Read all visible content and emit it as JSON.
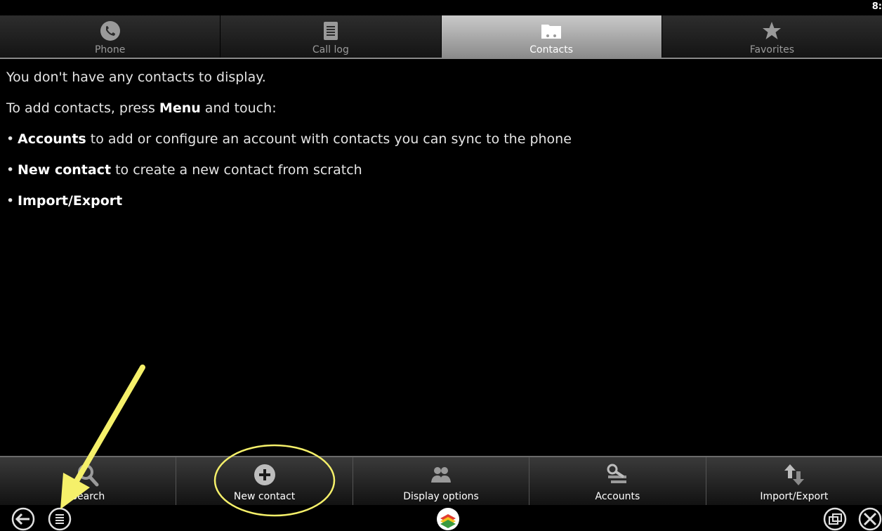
{
  "status": {
    "clock": "8:"
  },
  "tabs": [
    {
      "label": "Phone",
      "icon": "phone-icon",
      "active": false
    },
    {
      "label": "Call log",
      "icon": "call-log-icon",
      "active": false
    },
    {
      "label": "Contacts",
      "icon": "contacts-folder-icon",
      "active": true
    },
    {
      "label": "Favorites",
      "icon": "star-icon",
      "active": false
    }
  ],
  "content": {
    "empty_message": "You don't have any contacts to display.",
    "instruction_prefix": "To add contacts, press ",
    "instruction_bold": "Menu",
    "instruction_suffix": " and touch:",
    "bullets": [
      {
        "bold": "Accounts",
        "text": " to add or configure an account with contacts you can sync to the phone"
      },
      {
        "bold": "New contact",
        "text": " to create a new contact from scratch"
      },
      {
        "bold": "Import/Export",
        "text": ""
      }
    ]
  },
  "menu": [
    {
      "label": "Search",
      "icon": "search-icon"
    },
    {
      "label": "New contact",
      "icon": "add-circle-icon"
    },
    {
      "label": "Display options",
      "icon": "people-icon"
    },
    {
      "label": "Accounts",
      "icon": "accounts-icon"
    },
    {
      "label": "Import/Export",
      "icon": "import-export-icon"
    }
  ],
  "colors": {
    "background": "#000000",
    "annotation": "#f5f06a",
    "active_tab": "#a9a9a9"
  }
}
